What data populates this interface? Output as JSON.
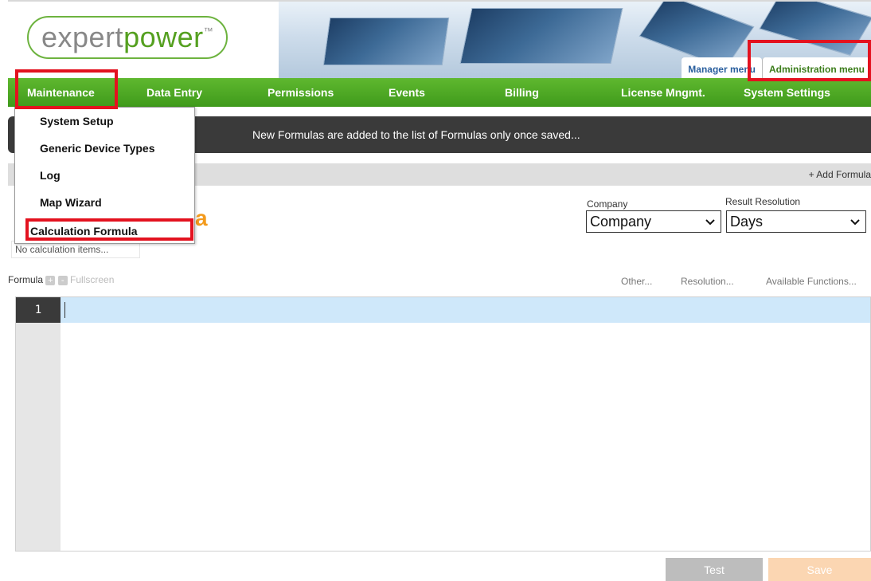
{
  "header": {
    "logo_part1": "expert",
    "logo_part2": "power",
    "logo_tm": "™",
    "manager_menu": "Manager menu",
    "admin_menu": "Administration menu"
  },
  "nav": {
    "items": [
      "Maintenance",
      "Data Entry",
      "Permissions",
      "Events",
      "Billing",
      "License Mngmt.",
      "System Settings"
    ]
  },
  "dropdown": {
    "items": [
      "System Setup",
      "Generic Device Types",
      "Log",
      "Map Wizard",
      "Calculation Formula"
    ]
  },
  "message": "New Formulas are added to the list of Formulas only once saved...",
  "toolbar": {
    "add_formula": "+ Add Formula"
  },
  "page": {
    "title_fragment": "a",
    "no_items": "No calculation items..."
  },
  "company": {
    "label": "Company",
    "value": "Company"
  },
  "resolution": {
    "label": "Result Resolution",
    "value": "Days"
  },
  "formula_toolbar": {
    "label": "Formula",
    "plus": "+",
    "minus": "-",
    "fullscreen": "Fullscreen",
    "other": "Other...",
    "resolution": "Resolution...",
    "functions": "Available Functions..."
  },
  "editor": {
    "line_number": "1"
  },
  "buttons": {
    "test": "Test",
    "save": "Save"
  },
  "colors": {
    "nav_green": "#4aa626",
    "highlight_red": "#e3121f",
    "accent_orange": "#f39a1c"
  }
}
